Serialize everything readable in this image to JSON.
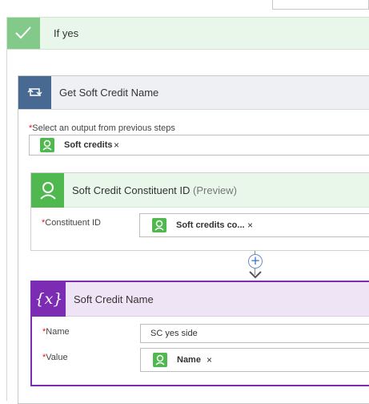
{
  "branch": {
    "title": "If yes"
  },
  "foreach": {
    "title": "Get Soft Credit Name",
    "select_label": "Select an output from previous steps",
    "select_token": "Soft credits"
  },
  "constituent_card": {
    "title": "Soft Credit Constituent ID",
    "preview": "(Preview)",
    "id_label": "Constituent ID",
    "id_token": "Soft credits co..."
  },
  "connector": {
    "add_symbol": "+"
  },
  "variable_card": {
    "icon_text": "{x}",
    "title": "Soft Credit Name",
    "name_label": "Name",
    "name_value": "SC yes side",
    "value_label": "Value",
    "value_token": "Name"
  },
  "common": {
    "required_mark": "*",
    "remove_symbol": "×"
  },
  "colors": {
    "branch_accent": "#82c98a",
    "foreach_accent": "#486991",
    "connector_accent": "#4fb84f",
    "variable_accent": "#7c2bb3"
  }
}
